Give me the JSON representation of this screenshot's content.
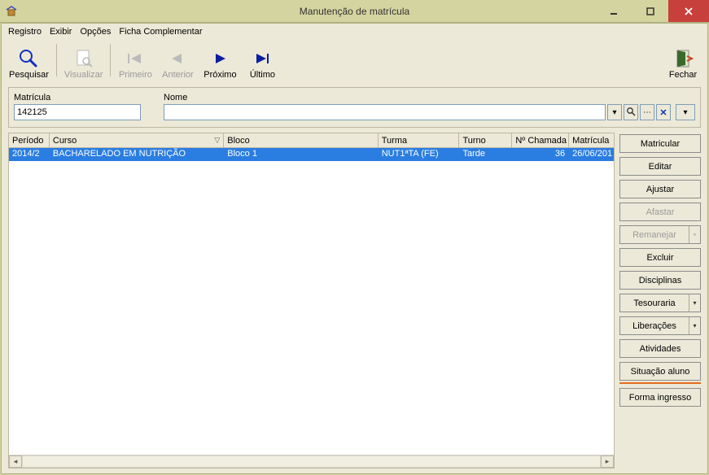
{
  "window": {
    "title": "Manutenção de matrícula"
  },
  "menubar": {
    "registro": "Registro",
    "exibir": "Exibir",
    "opcoes": "Opções",
    "ficha": "Ficha Complementar"
  },
  "toolbar": {
    "pesquisar": "Pesquisar",
    "visualizar": "Visualizar",
    "primeiro": "Primeiro",
    "anterior": "Anterior",
    "proximo": "Próximo",
    "ultimo": "Último",
    "fechar": "Fechar"
  },
  "search": {
    "matricula_label": "Matrícula",
    "matricula_value": "142125",
    "nome_label": "Nome",
    "nome_value": ""
  },
  "grid": {
    "headers": {
      "periodo": "Período",
      "curso": "Curso",
      "bloco": "Bloco",
      "turma": "Turma",
      "turno": "Turno",
      "chamada": "Nº Chamada",
      "matricula": "Matrícula"
    },
    "rows": [
      {
        "periodo": "2014/2",
        "curso": "BACHARELADO EM NUTRIÇÃO",
        "bloco": "Bloco 1",
        "turma": "NUT1ªTA   (FE)",
        "turno": "Tarde",
        "chamada": "36",
        "matricula": "26/06/201"
      }
    ]
  },
  "sidebuttons": {
    "matricular": "Matricular",
    "editar": "Editar",
    "ajustar": "Ajustar",
    "afastar": "Afastar",
    "remanejar": "Remanejar",
    "excluir": "Excluir",
    "disciplinas": "Disciplinas",
    "tesouraria": "Tesouraria",
    "liberacoes": "Liberações",
    "atividades": "Atividades",
    "situacao": "Situação aluno",
    "forma": "Forma ingresso"
  }
}
